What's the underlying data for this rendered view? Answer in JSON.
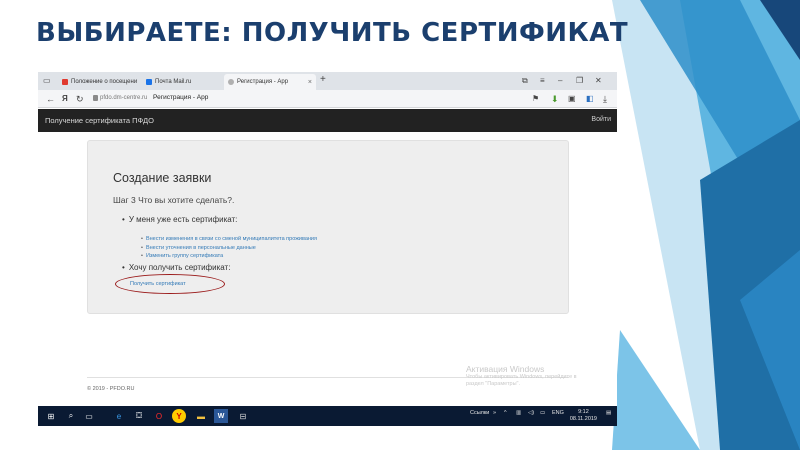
{
  "slide": {
    "title": "ВЫБИРАЕТЕ: ПОЛУЧИТЬ СЕРТИФИКАТ"
  },
  "browser": {
    "tabs": [
      {
        "label": "Положение о посещени",
        "icon": "yandex-icon",
        "color": "#e03a2f"
      },
      {
        "label": "Почта Mail.ru",
        "icon": "mail-icon",
        "color": "#1a73e8"
      },
      {
        "label": "Регистрация - App",
        "icon": "globe-icon",
        "color": "#888888"
      }
    ],
    "new_tab": "+",
    "url_domain": "pfdo.dm-centre.ru",
    "url_page": "Регистрация - App"
  },
  "site": {
    "header_title": "Получение сертификата ПФДО",
    "login": "Войти",
    "card_title": "Создание заявки",
    "step": "Шаг 3 Что вы хотите сделать?.",
    "option_have": "У меня уже есть сертификат:",
    "have_links": [
      "Внести изменения в связи со сменой муниципалитета проживания",
      "Внести уточнения в персональные данные",
      "Изменить группу сертификата"
    ],
    "option_want": "Хочу получить сертификат:",
    "get_link": "Получить сертификат",
    "copyright": "© 2019 - PFDO.RU"
  },
  "activation": {
    "title": "Активация Windows",
    "line1": "Чтобы активировать Windows, перейдите в",
    "line2": "раздел \"Параметры\"."
  },
  "taskbar": {
    "links_label": "Ссылки",
    "lang": "ENG",
    "time": "9:12",
    "date": "08.11.2019"
  },
  "colors": {
    "title": "#1b3f6e",
    "link": "#337ab7",
    "highlight_oval": "#9b1c1c",
    "header_bg": "#222222",
    "taskbar_bg": "#0a1a33"
  }
}
